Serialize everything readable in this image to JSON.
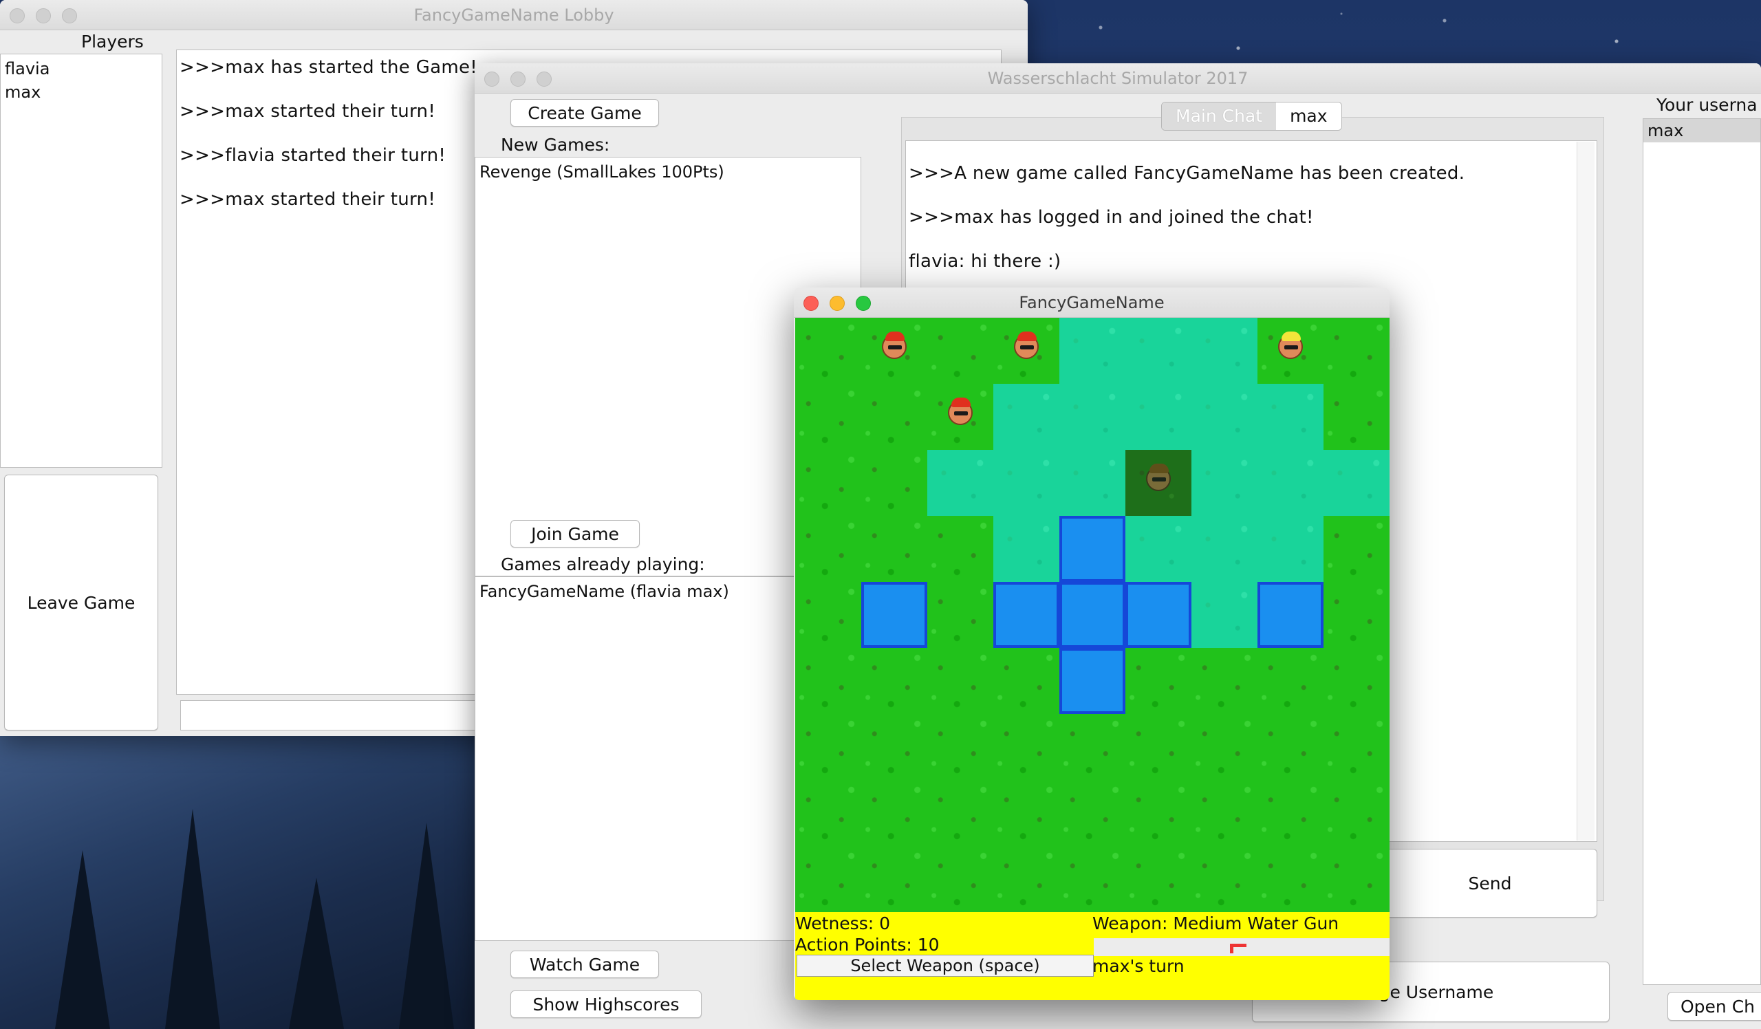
{
  "lobby": {
    "title": "FancyGameName Lobby",
    "players_label": "Players",
    "players": [
      "flavia",
      "max"
    ],
    "leave_button": "Leave Game",
    "chat": [
      ">>>max has started the Game!",
      ">>>max started their turn!",
      ">>>flavia started their turn!",
      ">>>max started their turn!"
    ]
  },
  "main": {
    "title": "Wasserschlacht Simulator 2017",
    "create_button": "Create Game",
    "new_games_label": "New Games:",
    "new_games": [
      "Revenge (SmallLakes 100Pts)"
    ],
    "join_button": "Join Game",
    "playing_label": "Games already playing:",
    "playing_games": [
      "FancyGameName (flavia max)"
    ],
    "watch_button": "Watch Game",
    "highscores_button": "Show Highscores",
    "tabs": [
      "Main Chat",
      "max"
    ],
    "chat": [
      ">>>A new game called FancyGameName has been created.",
      ">>>max has logged in and joined the chat!",
      "flavia: hi there :)"
    ],
    "send_button": "Send",
    "change_username_button": "nge Username",
    "username_label": "Your userna",
    "users": [
      "max"
    ],
    "open_chat_button": "Open Ch"
  },
  "game": {
    "title": "FancyGameName",
    "board": [
      [
        "g",
        "g",
        "g",
        "g",
        "s",
        "s",
        "s",
        "g",
        "g"
      ],
      [
        "g",
        "g",
        "g",
        "s",
        "s",
        "s",
        "s",
        "s",
        "g"
      ],
      [
        "g",
        "g",
        "s",
        "s",
        "s",
        "d",
        "s",
        "s",
        "s"
      ],
      [
        "g",
        "g",
        "g",
        "s",
        "w",
        "s",
        "s",
        "s",
        "g"
      ],
      [
        "g",
        "w",
        "g",
        "w",
        "w",
        "w",
        "s",
        "w",
        "g"
      ],
      [
        "g",
        "g",
        "g",
        "g",
        "w",
        "g",
        "g",
        "g",
        "g"
      ],
      [
        "g",
        "g",
        "g",
        "g",
        "g",
        "g",
        "g",
        "g",
        "g"
      ],
      [
        "g",
        "g",
        "g",
        "g",
        "g",
        "g",
        "g",
        "g",
        "g"
      ],
      [
        "g",
        "g",
        "g",
        "g",
        "g",
        "g",
        "g",
        "g",
        "g"
      ]
    ],
    "characters": [
      {
        "row": 0,
        "col": 1,
        "hair": "#e0301e",
        "dim": false
      },
      {
        "row": 0,
        "col": 3,
        "hair": "#e0301e",
        "dim": false
      },
      {
        "row": 0,
        "col": 7,
        "hair": "#f2e53a",
        "dim": false
      },
      {
        "row": 1,
        "col": 2,
        "hair": "#e0301e",
        "dim": false
      },
      {
        "row": 2,
        "col": 5,
        "hair": "#6b4a1a",
        "dim": true
      }
    ],
    "wetness": "Wetness: 0",
    "action_points": "Action Points: 10",
    "weapon": "Weapon: Medium Water Gun",
    "select_weapon": "Select Weapon (space)",
    "turn": "max's turn"
  }
}
